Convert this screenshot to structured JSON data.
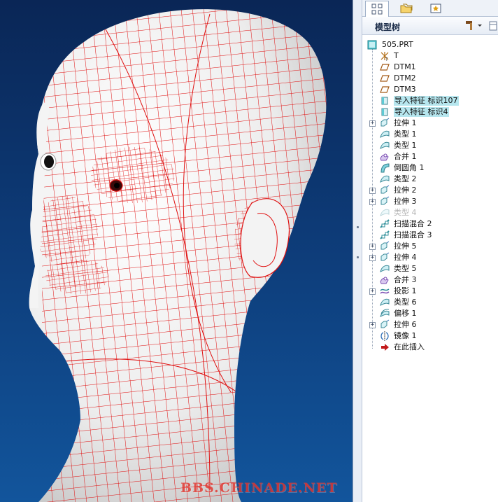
{
  "watermark": "BBS.CHINADE.NET",
  "navigator": {
    "tabs": [
      {
        "name": "tab-model-tree",
        "icon": "model-tree-icon",
        "active": true
      },
      {
        "name": "tab-folder-browser",
        "icon": "folder-icon",
        "active": false
      },
      {
        "name": "tab-favorites",
        "icon": "favorites-icon",
        "active": false
      }
    ],
    "tree_title": "模型树",
    "tree_tools_icon": "hammer-settings-icon"
  },
  "model_tree": {
    "root": {
      "label": "505.PRT",
      "icon": "part-icon"
    },
    "items": [
      {
        "label": "T",
        "icon": "csys-icon",
        "expandable": false,
        "state": "normal"
      },
      {
        "label": "DTM1",
        "icon": "datum-plane-icon",
        "expandable": false,
        "state": "normal"
      },
      {
        "label": "DTM2",
        "icon": "datum-plane-icon",
        "expandable": false,
        "state": "normal"
      },
      {
        "label": "DTM3",
        "icon": "datum-plane-icon",
        "expandable": false,
        "state": "normal"
      },
      {
        "label": "导入特征 标识107",
        "icon": "import-feature-icon",
        "expandable": false,
        "state": "highlight"
      },
      {
        "label": "导入特征 标识4",
        "icon": "import-feature-icon",
        "expandable": false,
        "state": "highlight"
      },
      {
        "label": "拉伸 1",
        "icon": "extrude-icon",
        "expandable": true,
        "state": "normal"
      },
      {
        "label": "类型 1",
        "icon": "surface-type-icon",
        "expandable": false,
        "state": "normal"
      },
      {
        "label": "类型 1",
        "icon": "surface-type-icon",
        "expandable": false,
        "state": "normal"
      },
      {
        "label": "合并 1",
        "icon": "merge-icon",
        "expandable": false,
        "state": "normal"
      },
      {
        "label": "倒圆角 1",
        "icon": "round-icon",
        "expandable": false,
        "state": "normal"
      },
      {
        "label": "类型 2",
        "icon": "surface-type-icon",
        "expandable": false,
        "state": "normal"
      },
      {
        "label": "拉伸 2",
        "icon": "extrude-icon",
        "expandable": true,
        "state": "normal"
      },
      {
        "label": "拉伸 3",
        "icon": "extrude-icon",
        "expandable": true,
        "state": "normal"
      },
      {
        "label": "类型 4",
        "icon": "surface-type-icon",
        "expandable": false,
        "state": "suppressed"
      },
      {
        "label": "扫描混合 2",
        "icon": "swept-blend-icon",
        "expandable": false,
        "state": "normal"
      },
      {
        "label": "扫描混合 3",
        "icon": "swept-blend-icon",
        "expandable": false,
        "state": "normal"
      },
      {
        "label": "拉伸 5",
        "icon": "extrude-icon",
        "expandable": true,
        "state": "normal"
      },
      {
        "label": "拉伸 4",
        "icon": "extrude-icon",
        "expandable": true,
        "state": "normal"
      },
      {
        "label": "类型 5",
        "icon": "surface-type-icon",
        "expandable": false,
        "state": "normal"
      },
      {
        "label": "合并 3",
        "icon": "merge-icon",
        "expandable": false,
        "state": "normal"
      },
      {
        "label": "投影 1",
        "icon": "project-icon",
        "expandable": true,
        "state": "normal"
      },
      {
        "label": "类型 6",
        "icon": "surface-type-icon",
        "expandable": false,
        "state": "normal"
      },
      {
        "label": "偏移 1",
        "icon": "offset-icon",
        "expandable": false,
        "state": "normal"
      },
      {
        "label": "拉伸 6",
        "icon": "extrude-icon",
        "expandable": true,
        "state": "normal"
      },
      {
        "label": "镜像 1",
        "icon": "mirror-icon",
        "expandable": false,
        "state": "normal"
      },
      {
        "label": "在此插入",
        "icon": "insert-here-arrow-icon",
        "expandable": false,
        "state": "normal"
      }
    ]
  },
  "colors": {
    "wireframe": "#e01010",
    "model_surface": "#f1f1f1",
    "viewport_bg_top": "#0a2656",
    "viewport_bg_bottom": "#12559c",
    "highlight": "#b6e6ee"
  }
}
